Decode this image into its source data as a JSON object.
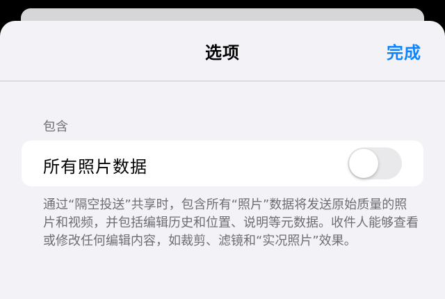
{
  "nav": {
    "title": "选项",
    "done_label": "完成"
  },
  "section": {
    "header": "包含",
    "row_label": "所有照片数据",
    "toggle_on": false,
    "footer": "通过“隔空投送”共享时，包含所有“照片”数据将发送原始质量的照片和视频，并包括编辑历史和位置、说明等元数据。收件人能够查看或修改任何编辑内容，如裁剪、滤镜和“实况照片”效果。"
  },
  "colors": {
    "accent": "#0a84ff",
    "background": "#f2f2f7",
    "secondary_text": "#6d6d72",
    "toggle_off": "#e9e9eb"
  }
}
